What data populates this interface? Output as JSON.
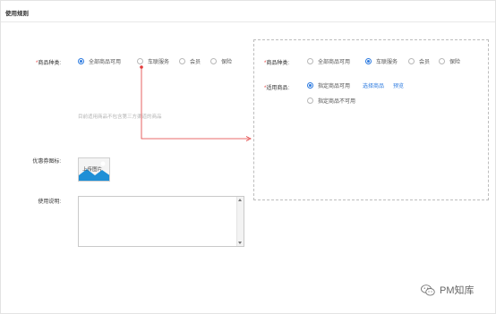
{
  "section": {
    "title": "使用规则"
  },
  "form": {
    "product_type": {
      "required_mark": "*",
      "label": "商品种类:",
      "options": [
        {
          "label": "全部商品可用",
          "selected": true
        },
        {
          "label": "车联服务",
          "selected": false
        },
        {
          "label": "会员",
          "selected": false
        },
        {
          "label": "保险",
          "selected": false
        }
      ]
    },
    "hint": "目前适用商品不包含第三方渠道的商品",
    "coupon_icon": {
      "label": "优惠券图标:",
      "upload_label": "上传图片"
    },
    "usage": {
      "label": "使用说明:",
      "value": ""
    }
  },
  "variant_panel": {
    "product_type": {
      "required_mark": "*",
      "label": "商品种类:",
      "options": [
        {
          "label": "全部商品可用",
          "selected": false
        },
        {
          "label": "车联服务",
          "selected": true
        },
        {
          "label": "会员",
          "selected": false
        },
        {
          "label": "保险",
          "selected": false
        }
      ]
    },
    "applicable": {
      "required_mark": "*",
      "label": "适用商品:",
      "options": [
        {
          "label": "指定商品可用",
          "selected": true
        },
        {
          "label": "指定商品不可用",
          "selected": false
        }
      ],
      "select_link": "选择商品",
      "preview_link": "预览"
    }
  },
  "annotation": {
    "color": "#e23b3b"
  },
  "watermark": {
    "text": "PM知库",
    "icon": "wechat-icon"
  },
  "colors": {
    "accent": "#2d7be0",
    "required": "#e83e3e"
  }
}
